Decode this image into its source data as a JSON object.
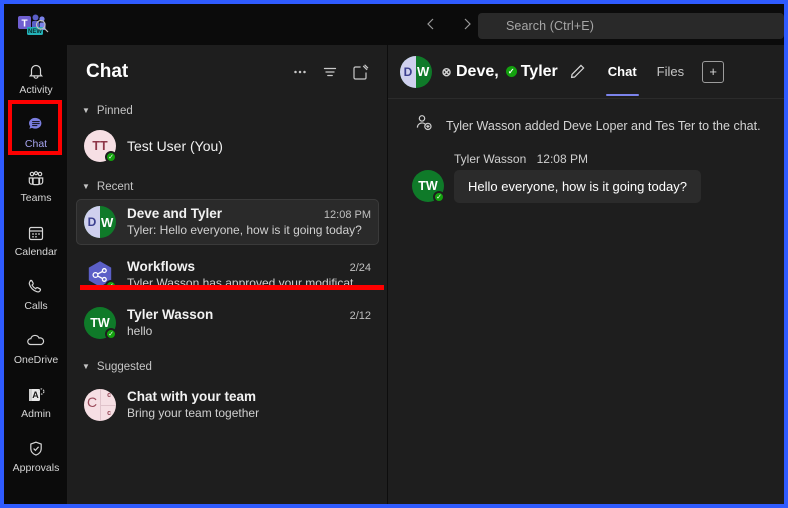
{
  "app": {
    "logo_name": "teams-logo",
    "logo_badge": "NEW"
  },
  "titlebar": {
    "back_label": "‹",
    "forward_label": "›",
    "search_placeholder": "Search (Ctrl+E)",
    "search_value": ""
  },
  "rail": {
    "items": [
      {
        "label": "Activity",
        "icon": "bell-icon",
        "active": false
      },
      {
        "label": "Chat",
        "icon": "chat-bubble-icon",
        "active": true
      },
      {
        "label": "Teams",
        "icon": "teams-people-icon",
        "active": false
      },
      {
        "label": "Calendar",
        "icon": "calendar-icon",
        "active": false
      },
      {
        "label": "Calls",
        "icon": "phone-icon",
        "active": false
      },
      {
        "label": "OneDrive",
        "icon": "cloud-icon",
        "active": false
      },
      {
        "label": "Admin",
        "icon": "admin-icon",
        "active": false
      },
      {
        "label": "Approvals",
        "icon": "approvals-shield-icon",
        "active": false
      }
    ]
  },
  "chat_panel": {
    "title": "Chat",
    "toolbar": {
      "more_label": "···",
      "filter_name": "filter-icon",
      "compose_name": "compose-icon"
    },
    "groups": [
      {
        "name": "Pinned",
        "items": [
          {
            "name": "Test User (You)",
            "preview": "",
            "time": "",
            "avatar_initials": "TT",
            "avatar_style": "pink",
            "presence": "available",
            "selected": false,
            "single_line": true
          }
        ]
      },
      {
        "name": "Recent",
        "items": [
          {
            "name": "Deve and Tyler",
            "preview": "Tyler: Hello everyone, how is it going today?",
            "time": "12:08 PM",
            "avatar_initials": "DW",
            "avatar_style": "split",
            "presence": "none",
            "selected": true,
            "single_line": false
          },
          {
            "name": "Workflows",
            "preview": "Tyler Wasson has approved your modificat...",
            "time": "2/24",
            "avatar_initials": "",
            "avatar_style": "hex",
            "presence": "available",
            "selected": false,
            "single_line": false
          },
          {
            "name": "Tyler Wasson",
            "preview": "hello",
            "time": "2/12",
            "avatar_initials": "TW",
            "avatar_style": "green",
            "presence": "available",
            "selected": false,
            "single_line": false
          }
        ]
      },
      {
        "name": "Suggested",
        "items": [
          {
            "name": "Chat with your team",
            "preview": "Bring your team together",
            "time": "",
            "avatar_initials": "C",
            "avatar_style": "quad",
            "presence": "none",
            "selected": false,
            "single_line": false
          }
        ]
      }
    ]
  },
  "conversation": {
    "avatar_initials": "DW",
    "participants": [
      {
        "name": "Deve,",
        "status": "blocked",
        "status_glyph": "⊗"
      },
      {
        "name": "Tyler",
        "status": "available",
        "status_glyph": "✓"
      }
    ],
    "edit_icon": "pencil-icon",
    "tabs": [
      {
        "label": "Chat",
        "active": true
      },
      {
        "label": "Files",
        "active": false
      }
    ],
    "add_tab_label": "+",
    "system_message": "Tyler Wasson added Deve Loper and Tes Ter to the chat.",
    "system_icon": "person-add-icon",
    "message": {
      "sender": "Tyler Wasson",
      "time": "12:08 PM",
      "avatar_initials": "TW",
      "text": "Hello everyone, how is it going today?"
    }
  },
  "annotations": {
    "highlight_color": "#fe0000",
    "frame_color": "#2f5bff"
  }
}
